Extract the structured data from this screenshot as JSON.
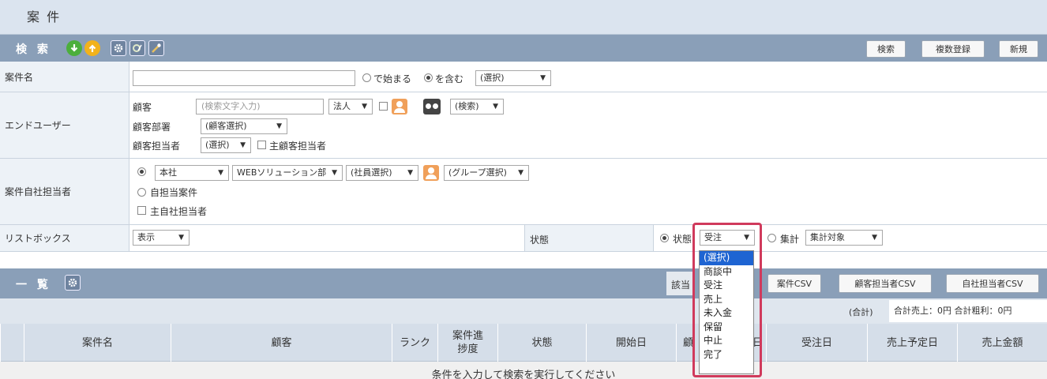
{
  "title": "案 件",
  "search_section": {
    "label": "検 索",
    "buttons": {
      "search": "検索",
      "bulk_register": "複数登録",
      "new": "新規"
    }
  },
  "case_name": {
    "label": "案件名",
    "value": "",
    "radio_starts_with": "で始まる",
    "radio_contains": "を含む",
    "select": "(選択)"
  },
  "end_user": {
    "label": "エンドユーザー",
    "customer_label": "顧客",
    "customer_placeholder": "(検索文字入力)",
    "corp_select": "法人",
    "search_select": "(検索)",
    "dept_label": "顧客部署",
    "dept_select": "(顧客選択)",
    "person_label": "顧客担当者",
    "person_select": "(選択)",
    "main_person_label": "主顧客担当者"
  },
  "own_staff": {
    "label": "案件自社担当者",
    "office_select": "本社",
    "division_select": "WEBソリューション部",
    "employee_select": "(社員選択)",
    "group_select": "(グループ選択)",
    "self_case_label": "自担当案件",
    "main_staff_label": "主自社担当者"
  },
  "listbox": {
    "label": "リストボックス",
    "select": "表示",
    "status_label": "状態",
    "status_radio": "状態",
    "status_select": "受注",
    "aggregate_radio": "集計",
    "aggregate_select": "集計対象"
  },
  "list_section": {
    "label": "一 覧",
    "count_label": "該当",
    "buttons": {
      "case_csv": "案件CSV",
      "customer_csv": "顧客担当者CSV",
      "own_csv": "自社担当者CSV"
    }
  },
  "summary": {
    "total_label": "(合計)",
    "totals": "合計売上：0円 合計粗利：0円"
  },
  "table": {
    "headers": [
      "案件名",
      "顧客",
      "ランク",
      "案件進\n捗度",
      "状態",
      "開始日",
      "",
      "受注日",
      "売上予定日",
      "売上金額"
    ],
    "hidden_header_tail": "日",
    "empty_message": "条件を入力して検索を実行してください"
  },
  "dropdown": {
    "options": [
      "(選択)",
      "商談中",
      "受注",
      "売上",
      "未入金",
      "保留",
      "中止",
      "完了"
    ],
    "selected_index": 0
  },
  "colors": {
    "section_bar": "#8a9fb8",
    "highlight": "#d03a5c",
    "selected": "#1e64d2"
  }
}
